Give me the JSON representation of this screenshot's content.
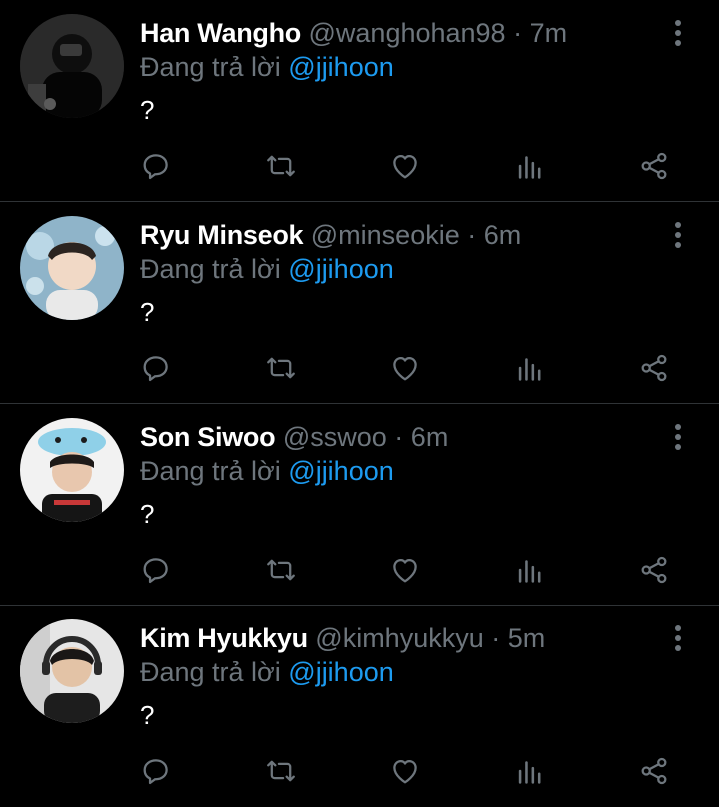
{
  "colors": {
    "background": "#000000",
    "primary_text": "#ffffff",
    "secondary_text": "#6e767d",
    "mention": "#1d9bf0",
    "divider": "#2f3336"
  },
  "reply_prefix": "Đang trả lời",
  "separator": "·",
  "tweets": [
    {
      "display_name": "Han Wangho",
      "handle": "@wanghohan98",
      "time": "7m",
      "mention": "@jjihoon",
      "text": "?"
    },
    {
      "display_name": "Ryu Minseok",
      "handle": "@minseokie",
      "time": "6m",
      "mention": "@jjihoon",
      "text": "?"
    },
    {
      "display_name": "Son Siwoo",
      "handle": "@sswoo",
      "time": "6m",
      "mention": "@jjihoon",
      "text": "?"
    },
    {
      "display_name": "Kim Hyukkyu",
      "handle": "@kimhyukkyu",
      "time": "5m",
      "mention": "@jjihoon",
      "text": "?"
    }
  ],
  "icons": {
    "more": "more-vertical-icon",
    "reply": "reply-bubble-icon",
    "retweet": "retweet-icon",
    "like": "heart-icon",
    "views": "analytics-bars-icon",
    "share": "share-nodes-icon"
  }
}
